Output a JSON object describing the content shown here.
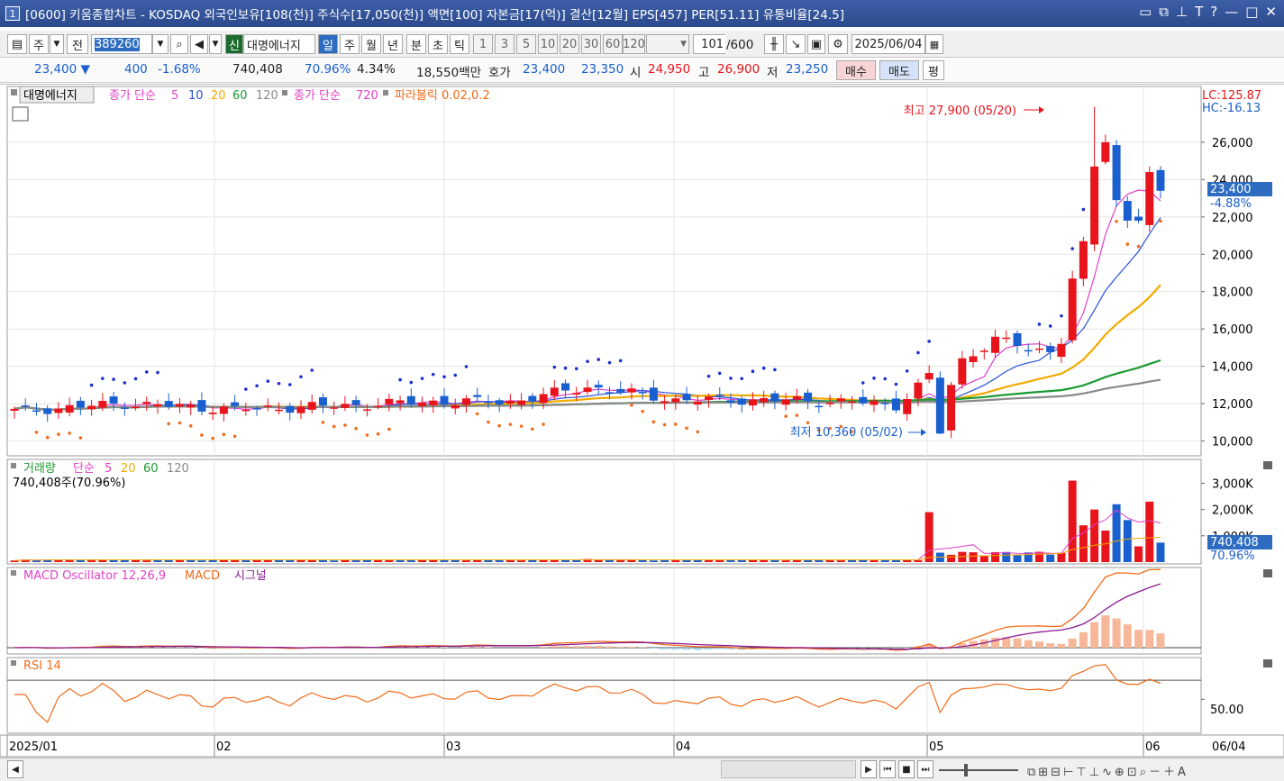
{
  "window": {
    "number": "1",
    "title": "[0600] 키움종합차트 - KOSDAQ 외국인보유[108(천)] 주식수[17,050(천)] 액면[100] 자본금[17(억)] 결산[12월] EPS[457] PER[51.11] 유통비율[24.5]"
  },
  "toolbar": {
    "market_label": "주",
    "all_label": "전",
    "code": "389260",
    "stock_name": "대명에너지",
    "shin_label": "신",
    "periods": [
      "일",
      "주",
      "월",
      "년"
    ],
    "intraday": [
      "분",
      "초",
      "틱"
    ],
    "intervals": [
      "1",
      "3",
      "5",
      "10",
      "20",
      "30",
      "60",
      "120"
    ],
    "count": "101",
    "count_total": "/600",
    "date": "2025/06/04"
  },
  "quote": {
    "price": "23,400",
    "change": "400",
    "change_pct": "-1.68%",
    "volume": "740,408",
    "ratio": "70.96%",
    "turnover": "4.34%",
    "amount": "18,550백만",
    "hoga_label": "호가",
    "ask": "23,400",
    "bid": "23,350",
    "open_label": "시",
    "open": "24,950",
    "high_label": "고",
    "high": "26,900",
    "low_label": "저",
    "low": "23,250",
    "buy_label": "매수",
    "sell_label": "매도",
    "avg_label": "평"
  },
  "colors": {
    "up": "#e8141b",
    "down": "#1a5fcf",
    "ma5": "#e040c8",
    "ma10": "#2850d8",
    "ma20": "#f0aa00",
    "ma60": "#1a9a30",
    "ma120": "#8a8a8a",
    "sar": "#f06b1a"
  },
  "legend": {
    "name": "대명에너지",
    "ma_label": "종가 단순",
    "ma5": "5",
    "ma10": "10",
    "ma20": "20",
    "ma60": "60",
    "ma120": "120",
    "ma_label2": "종가 단순",
    "ma720": "720",
    "sar_label": "파라볼릭 0.02,0.2",
    "lc": "LC:125.87",
    "hc": "HC:-16.13"
  },
  "annotations": {
    "high": "최고 27,900 (05/20)",
    "low": "최저 10,360 (05/02)"
  },
  "price_box": {
    "price": "23,400",
    "pct": "-4.88%"
  },
  "volume": {
    "title": "거래량",
    "ma_label": "단순",
    "ma5": "5",
    "ma20": "20",
    "ma60": "60",
    "ma120": "120",
    "current": "740,408주(70.96%)",
    "last_box": "740,408",
    "last_pct": "70.96%"
  },
  "macd": {
    "title": "MACD Oscillator 12,26,9",
    "macd_label": "MACD",
    "signal_label": "시그널"
  },
  "rsi": {
    "title": "RSI 14",
    "level": "50.00"
  },
  "chart_data": {
    "type": "candlestick",
    "price_axis": {
      "ticks": [
        10000,
        12000,
        14000,
        16000,
        18000,
        20000,
        22000,
        24000,
        26000
      ],
      "labels": [
        "10,000",
        "12,000",
        "14,000",
        "16,000",
        "18,000",
        "20,000",
        "22,000",
        "24,000",
        "26,000"
      ],
      "min": 9400,
      "max": 28600
    },
    "volume_axis": {
      "labels": [
        "3,000K",
        "2,000K",
        "1,000K"
      ],
      "ticks": [
        3000000,
        2000000,
        1000000
      ],
      "max": 3700000
    },
    "x_labels": [
      "2025/01",
      "02",
      "03",
      "04",
      "05",
      "06"
    ],
    "last_label": "06/04",
    "high": {
      "value": 27900,
      "date": "05/20"
    },
    "low": {
      "value": 10360,
      "date": "05/02"
    },
    "last": {
      "close": 23400,
      "volume": 740408
    }
  }
}
